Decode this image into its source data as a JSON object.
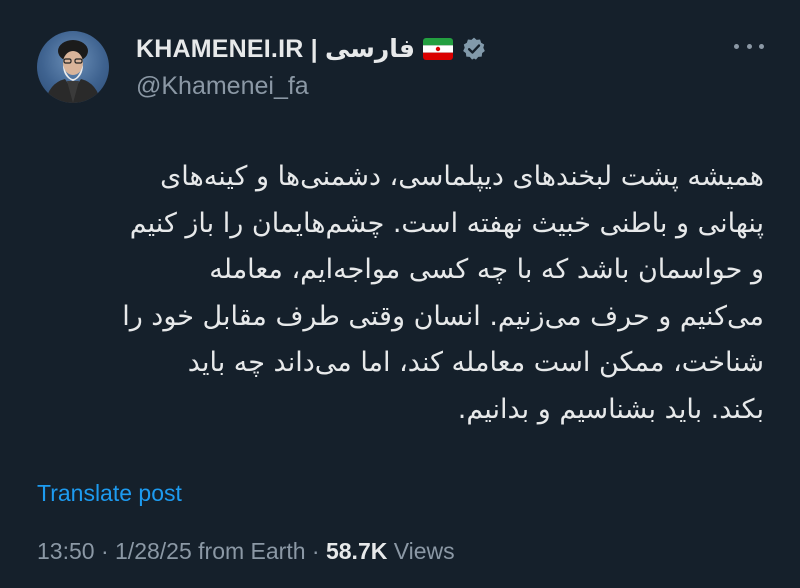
{
  "author": {
    "name": "KHAMENEI.IR | فارسی",
    "handle": "@Khamenei_fa",
    "avatar_icon": "profile-photo",
    "verified_icon": "verified-badge-icon",
    "flag_icon": "iran-flag-icon"
  },
  "more_icon": "more-options-icon",
  "tweet": {
    "lines": [
      "همیشه پشت لبخندهای دیپلماسی، دشمنی‌ها و کینه‌های",
      "پنهانی و باطنی خبیث نهفته است. چشم‌هایمان را باز کنیم",
      "و حواسمان باشد که با چه کسی مواجه‌ایم، معامله",
      "می‌کنیم و حرف می‌زنیم. انسان وقتی طرف مقابل خود را",
      "شناخت، ممکن است معامله کند، اما می‌داند چه باید",
      "بکند. باید بشناسیم و بدانیم."
    ]
  },
  "translate_label": "Translate post",
  "meta": {
    "time": "13:50",
    "separator": "·",
    "date_source": "1/28/25 from Earth",
    "views_count": "58.7K",
    "views_label": "Views"
  },
  "colors": {
    "background": "#15202b",
    "text": "#e7e9ea",
    "muted": "#8b98a5",
    "link": "#1d9bf0"
  }
}
